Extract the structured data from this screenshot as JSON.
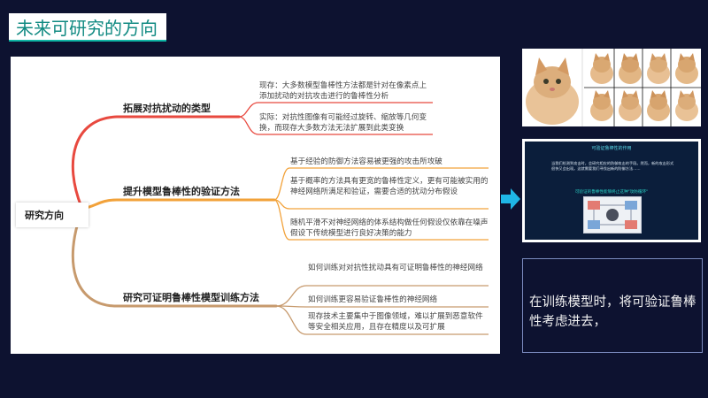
{
  "slide_title": "未来可研究的方向",
  "mindmap": {
    "root": "研究方向",
    "branches": [
      {
        "label": "拓展对抗扰动的类型",
        "children": [
          "现存：大多数模型鲁棒性方法都是针对在像素点上添加扰动的对抗攻击进行的鲁棒性分析",
          "实际：对抗性图像有可能经过旋转、缩放等几何变换，而现存大多数方法无法扩展到此类变换"
        ]
      },
      {
        "label": "提升模型鲁棒性的验证方法",
        "children": [
          "基于经验的防御方法容易被更强的攻击所攻破",
          "基于概率的方法具有更宽的鲁棒性定义，更有可能被实用的神经网络所满足和验证，需要合适的扰动分布假设",
          "随机平滑不对神经网络的体系结构做任何假设仅依靠在噪声假设下传统模型进行良好决策的能力"
        ]
      },
      {
        "label": "研究可证明鲁棒性模型训练方法",
        "children": [
          "如何训练对对抗性扰动具有可证明鲁棒性的神经网络",
          "如何训练更容易验证鲁棒性的神经网络",
          "现存技术主要集中于图像领域，难以扩展到恶意软件等安全相关应用，且存在精度以及可扩展"
        ]
      }
    ]
  },
  "thumbnail": {
    "title": "可验证鲁棒性的作用",
    "body": "当我们检测到攻击时，会研究相应的防御攻击的手段。然而，新的攻击形式很快又会出现。这就需要我们寻找出新的防御方法……",
    "highlight": "可验证的鲁棒性能够终止这种\"攻防循环\""
  },
  "callout_text": "在训练模型时，将可验证鲁棒性考虑进去，",
  "colors": {
    "background": "#0d1230",
    "title_text": "#108a82",
    "branch_1": "#e8493f",
    "branch_2": "#f2a23a",
    "branch_3": "#c79a6d",
    "arrow": "#1fb6e6"
  }
}
